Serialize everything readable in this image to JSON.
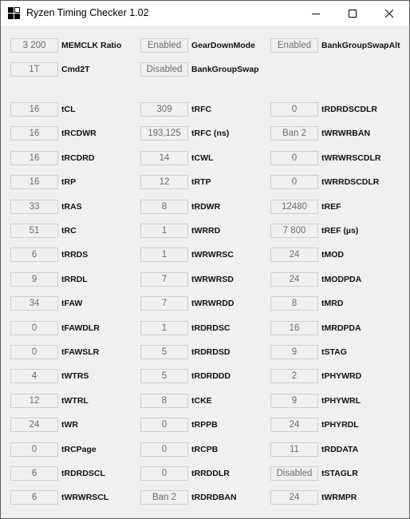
{
  "window": {
    "title": "Ryzen Timing Checker 1.02"
  },
  "top": [
    [
      {
        "value": "3 200",
        "label": "MEMCLK Ratio"
      },
      {
        "value": "Enabled",
        "label": "GearDownMode"
      },
      {
        "value": "Enabled",
        "label": "BankGroupSwapAlt"
      }
    ],
    [
      {
        "value": "1T",
        "label": "Cmd2T"
      },
      {
        "value": "Disabled",
        "label": "BankGroupSwap"
      }
    ]
  ],
  "timings": [
    [
      {
        "value": "16",
        "label": "tCL"
      },
      {
        "value": "309",
        "label": "tRFC"
      },
      {
        "value": "0",
        "label": "tRDRDSCDLR"
      }
    ],
    [
      {
        "value": "16",
        "label": "tRCDWR"
      },
      {
        "value": "193,125",
        "label": "tRFC (ns)"
      },
      {
        "value": "Ban 2",
        "label": "tWRWRBAN"
      }
    ],
    [
      {
        "value": "16",
        "label": "tRCDRD"
      },
      {
        "value": "14",
        "label": "tCWL"
      },
      {
        "value": "0",
        "label": "tWRWRSCDLR"
      }
    ],
    [
      {
        "value": "16",
        "label": "tRP"
      },
      {
        "value": "12",
        "label": "tRTP"
      },
      {
        "value": "0",
        "label": "tWRRDSCDLR"
      }
    ],
    [
      {
        "value": "33",
        "label": "tRAS"
      },
      {
        "value": "8",
        "label": "tRDWR"
      },
      {
        "value": "12480",
        "label": "tREF"
      }
    ],
    [
      {
        "value": "51",
        "label": "tRC"
      },
      {
        "value": "1",
        "label": "tWRRD"
      },
      {
        "value": "7 800",
        "label": "tREF (µs)"
      }
    ],
    [
      {
        "value": "6",
        "label": "tRRDS"
      },
      {
        "value": "1",
        "label": "tWRWRSC"
      },
      {
        "value": "24",
        "label": "tMOD"
      }
    ],
    [
      {
        "value": "9",
        "label": "tRRDL"
      },
      {
        "value": "7",
        "label": "tWRWRSD"
      },
      {
        "value": "24",
        "label": "tMODPDA"
      }
    ],
    [
      {
        "value": "34",
        "label": "tFAW"
      },
      {
        "value": "7",
        "label": "tWRWRDD"
      },
      {
        "value": "8",
        "label": "tMRD"
      }
    ],
    [
      {
        "value": "0",
        "label": "tFAWDLR"
      },
      {
        "value": "1",
        "label": "tRDRDSC"
      },
      {
        "value": "16",
        "label": "tMRDPDA"
      }
    ],
    [
      {
        "value": "0",
        "label": "tFAWSLR"
      },
      {
        "value": "5",
        "label": "tRDRDSD"
      },
      {
        "value": "9",
        "label": "tSTAG"
      }
    ],
    [
      {
        "value": "4",
        "label": "tWTRS"
      },
      {
        "value": "5",
        "label": "tRDRDDD"
      },
      {
        "value": "2",
        "label": "tPHYWRD"
      }
    ],
    [
      {
        "value": "12",
        "label": "tWTRL"
      },
      {
        "value": "8",
        "label": "tCKE"
      },
      {
        "value": "9",
        "label": "tPHYWRL"
      }
    ],
    [
      {
        "value": "24",
        "label": "tWR"
      },
      {
        "value": "0",
        "label": "tRPPB"
      },
      {
        "value": "24",
        "label": "tPHYRDL"
      }
    ],
    [
      {
        "value": "0",
        "label": "tRCPage"
      },
      {
        "value": "0",
        "label": "tRCPB"
      },
      {
        "value": "11",
        "label": "tRDDATA"
      }
    ],
    [
      {
        "value": "6",
        "label": "tRDRDSCL"
      },
      {
        "value": "0",
        "label": "tRRDDLR"
      },
      {
        "value": "Disabled",
        "label": "tSTAGLR"
      }
    ],
    [
      {
        "value": "6",
        "label": "tWRWRSCL"
      },
      {
        "value": "Ban 2",
        "label": "tRDRDBAN"
      },
      {
        "value": "24",
        "label": "tWRMPR"
      }
    ]
  ]
}
